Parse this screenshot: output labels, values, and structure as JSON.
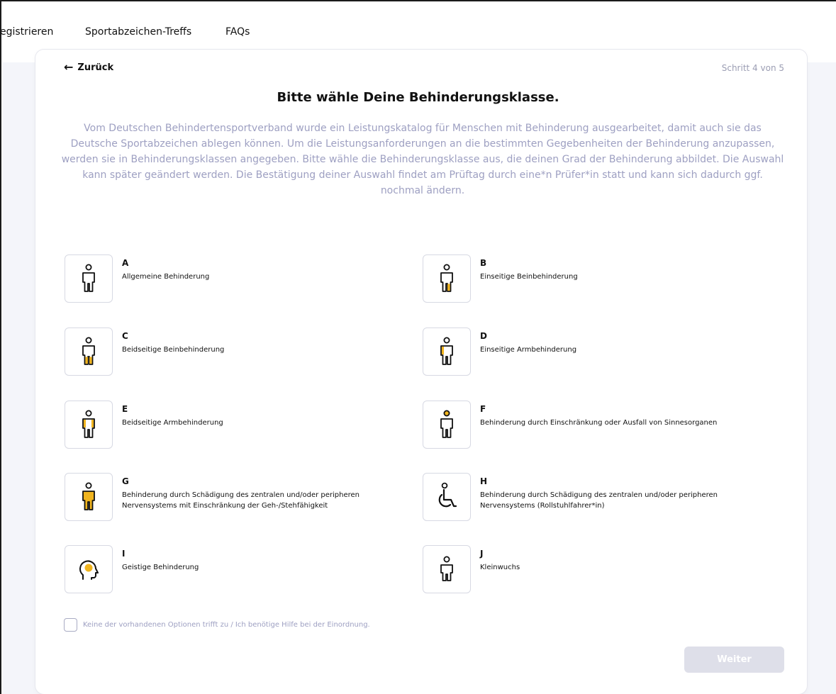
{
  "nav": {
    "items": [
      "egistrieren",
      "Sportabzeichen-Treffs",
      "FAQs"
    ]
  },
  "header": {
    "back_label": "Zurück",
    "back_icon": "arrow-left-icon",
    "step_label": "Schritt 4 von 5"
  },
  "main": {
    "title": "Bitte wähle Deine Behinderungsklasse.",
    "description": "Vom Deutschen Behindertensportverband wurde ein Leistungskatalog für Menschen mit Behinderung ausgearbeitet, damit auch sie das Deutsche Sportabzeichen ablegen können. Um die Leistungsanforderungen an die bestimmten Gegebenheiten der Behinderung anzupassen, werden sie in Behinderungsklassen angegeben. Bitte wähle die Behinderungsklasse aus, die deinen Grad der Behinderung abbildet. Die Auswahl kann später geändert werden. Die Bestätigung deiner Auswahl findet am Prüftag durch eine*n Prüfer*in statt und kann sich dadurch ggf. nochmal ändern."
  },
  "options": [
    {
      "letter": "A",
      "label": "Allgemeine Behinderung",
      "icon": "person-icon"
    },
    {
      "letter": "B",
      "label": "Einseitige Beinbehinderung",
      "icon": "person-one-leg-icon"
    },
    {
      "letter": "C",
      "label": "Beidseitige Beinbehinderung",
      "icon": "person-both-legs-icon"
    },
    {
      "letter": "D",
      "label": "Einseitige Armbehinderung",
      "icon": "person-one-arm-icon"
    },
    {
      "letter": "E",
      "label": "Beidseitige Armbehinderung",
      "icon": "person-both-arms-icon"
    },
    {
      "letter": "F",
      "label": "Behinderung durch Einschränkung oder Ausfall von Sinnesorganen",
      "icon": "person-head-icon"
    },
    {
      "letter": "G",
      "label": "Behinderung durch Schädigung des zentralen und/oder peripheren Nervensystems mit Einschränkung der Geh-/Stehfähigkeit",
      "icon": "person-full-icon"
    },
    {
      "letter": "H",
      "label": "Behinderung durch Schädigung des zentralen und/oder peripheren Nervensystems (Rollstuhlfahrer*in)",
      "icon": "wheelchair-icon"
    },
    {
      "letter": "I",
      "label": "Geistige Behinderung",
      "icon": "head-brain-icon"
    },
    {
      "letter": "J",
      "label": "Kleinwuchs",
      "icon": "person-short-icon"
    }
  ],
  "help": {
    "checkbox_label": "Keine der vorhandenen Optionen trifft zu / Ich benötige Hilfe bei der Einordnung.",
    "checked": false
  },
  "footer": {
    "next_label": "Weiter"
  },
  "colors": {
    "accent": "#F0B41E",
    "muted_text": "#9EA0C2",
    "border": "#D7D9E3",
    "panel_bg": "#F4F5FA",
    "disabled_button": "#DEDFE9"
  }
}
